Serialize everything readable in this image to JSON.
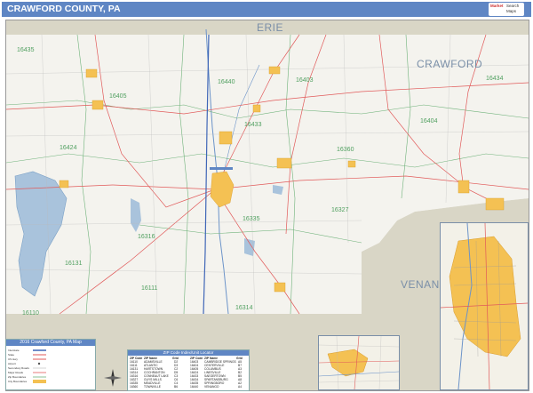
{
  "title": "CRAWFORD COUNTY, PA",
  "logo": {
    "brand": "Market",
    "l2": "Search",
    "l3": "Maps"
  },
  "regions": {
    "erie": "ERIE",
    "crawford": "CRAWFORD",
    "venango": "VENANGO"
  },
  "zip_labels": [
    "16435",
    "16405",
    "16403",
    "16433",
    "16440",
    "16434",
    "16424",
    "16404",
    "16360",
    "16327",
    "16316",
    "16131",
    "16111",
    "16314",
    "16110",
    "16335"
  ],
  "legend": {
    "title": "2016 Crawford County, PA Map",
    "rows": [
      "Interstate",
      "State",
      "US Hwy",
      "Airport",
      "Secondary Roads",
      "Major Roads",
      "Zip Boundaries",
      "City Boundaries"
    ]
  },
  "zip_index": {
    "title": "ZIP Code Index/Unit Locator",
    "headers": [
      "ZIP Code",
      "ZIP Name",
      "Grid"
    ],
    "rows": [
      [
        "16110",
        "ADAMSVILLE",
        "D2"
      ],
      [
        "16111",
        "ATLANTIC",
        "D3"
      ],
      [
        "16131",
        "HARTSTOWN",
        "C2"
      ],
      [
        "16314",
        "COCHRANTON",
        "D5"
      ],
      [
        "16316",
        "CONNEAUT LAKE",
        "C3"
      ],
      [
        "16327",
        "GUYS MILLS",
        "C6"
      ],
      [
        "16335",
        "MEADVILLE",
        "C4"
      ],
      [
        "16360",
        "TOWNVILLE",
        "B6"
      ],
      [
        "16403",
        "CAMBRIDGE SPRINGS",
        "A5"
      ],
      [
        "16404",
        "CENTERVILLE",
        "B7"
      ],
      [
        "16405",
        "COLUMBUS",
        "A3"
      ],
      [
        "16424",
        "LINESVILLE",
        "B2"
      ],
      [
        "16433",
        "SAEGERTOWN",
        "B5"
      ],
      [
        "16434",
        "SPARTANSBURG",
        "A8"
      ],
      [
        "16435",
        "SPRINGBORO",
        "A2"
      ],
      [
        "16440",
        "VENANGO",
        "A4"
      ]
    ]
  },
  "colors": {
    "title_bar": "#5f86c4",
    "land": "#f4f3ee",
    "outside": "#d9d6c6",
    "water": "#a9c3dc",
    "city": "#f4c153",
    "roads": "#e15a5a",
    "zip_lines": "#6fb27a"
  }
}
